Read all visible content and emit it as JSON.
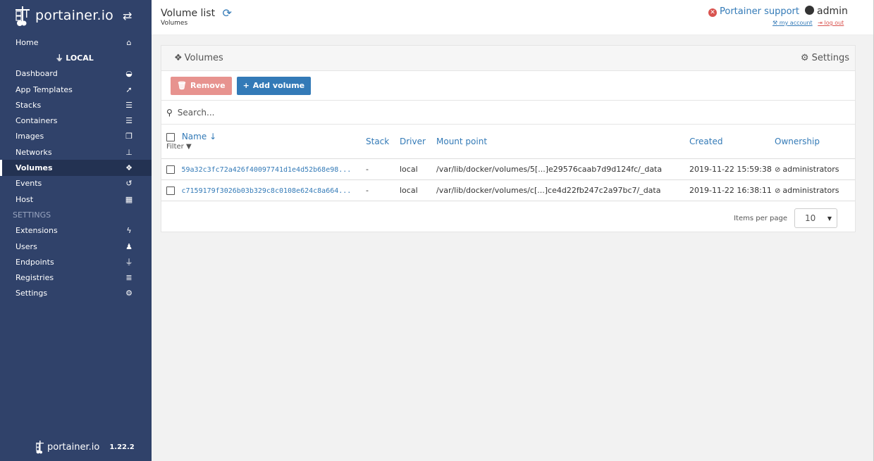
{
  "brand": {
    "name": "portainer.io",
    "toggle_icon": "exchange-icon"
  },
  "sidebar": {
    "items": [
      {
        "label": "Home",
        "icon": "home-icon",
        "glyph": "⌂"
      },
      {
        "label": "LOCAL",
        "icon": "plug-icon",
        "glyph": "⏚",
        "type": "endpoint"
      },
      {
        "label": "Dashboard",
        "icon": "tachometer-icon",
        "glyph": "◒"
      },
      {
        "label": "App Templates",
        "icon": "rocket-icon",
        "glyph": "➚"
      },
      {
        "label": "Stacks",
        "icon": "th-list-icon",
        "glyph": "☰"
      },
      {
        "label": "Containers",
        "icon": "server-icon",
        "glyph": "☰"
      },
      {
        "label": "Images",
        "icon": "clone-icon",
        "glyph": "❐"
      },
      {
        "label": "Networks",
        "icon": "sitemap-icon",
        "glyph": "⊥"
      },
      {
        "label": "Volumes",
        "icon": "cubes-icon",
        "glyph": "❖",
        "active": true
      },
      {
        "label": "Events",
        "icon": "history-icon",
        "glyph": "↺"
      },
      {
        "label": "Host",
        "icon": "th-icon",
        "glyph": "▦"
      },
      {
        "label": "SETTINGS",
        "type": "section"
      },
      {
        "label": "Extensions",
        "icon": "bolt-icon",
        "glyph": "ϟ"
      },
      {
        "label": "Users",
        "icon": "users-icon",
        "glyph": "♟"
      },
      {
        "label": "Endpoints",
        "icon": "plug-icon",
        "glyph": "⏚"
      },
      {
        "label": "Registries",
        "icon": "database-icon",
        "glyph": "≣"
      },
      {
        "label": "Settings",
        "icon": "cogs-icon",
        "glyph": "⚙"
      }
    ],
    "footer": {
      "name": "portainer.io",
      "version": "1.22.2"
    }
  },
  "header": {
    "title": "Volume list",
    "breadcrumb": "Volumes",
    "support_label": "Portainer support",
    "username": "admin",
    "my_account": "my account",
    "log_out": "log out"
  },
  "widget": {
    "title": "Volumes",
    "settings_label": "Settings",
    "remove_label": "Remove",
    "add_label": "Add volume",
    "search_placeholder": "Search...",
    "columns": {
      "name": "Name",
      "filter": "Filter",
      "stack": "Stack",
      "driver": "Driver",
      "mount": "Mount point",
      "created": "Created",
      "ownership": "Ownership"
    },
    "rows": [
      {
        "name": "59a32c3fc72a426f40097741d1e4d52b68e98...",
        "stack": "-",
        "driver": "local",
        "mount": "/var/lib/docker/volumes/5[...]e29576caab7d9d124fc/_data",
        "created": "2019-11-22 15:59:38",
        "ownership": "administrators"
      },
      {
        "name": "c7159179f3026b03b329c8c0108e624c8a664...",
        "stack": "-",
        "driver": "local",
        "mount": "/var/lib/docker/volumes/c[...]ce4d22fb247c2a97bc7/_data",
        "created": "2019-11-22 16:38:11",
        "ownership": "administrators"
      }
    ],
    "items_per_page_label": "Items per page",
    "items_per_page_value": "10"
  },
  "colors": {
    "sidebar_bg": "#30426a",
    "accent": "#337ab7",
    "danger": "#d9534f"
  }
}
